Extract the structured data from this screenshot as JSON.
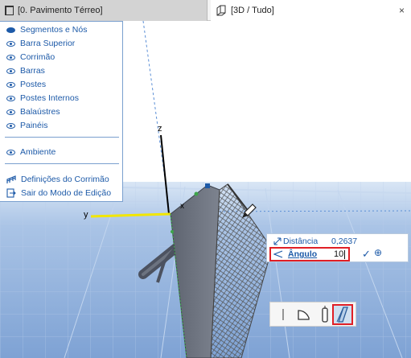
{
  "tabs": {
    "floor_plan": {
      "label": "[0. Pavimento Térreo]",
      "icon": "floor-plan-icon"
    },
    "view_3d": {
      "label": "[3D / Tudo]",
      "icon": "3d-window-icon",
      "close": "×"
    }
  },
  "palette": {
    "items": [
      {
        "label": "Segmentos e Nós",
        "icon": "eye-icon-filled"
      },
      {
        "label": "Barra Superior",
        "icon": "eye-icon"
      },
      {
        "label": "Corrimão",
        "icon": "eye-icon"
      },
      {
        "label": "Barras",
        "icon": "eye-icon"
      },
      {
        "label": "Postes",
        "icon": "eye-icon"
      },
      {
        "label": "Postes Internos",
        "icon": "eye-icon"
      },
      {
        "label": "Balaústres",
        "icon": "eye-icon"
      },
      {
        "label": "Painéis",
        "icon": "eye-icon"
      }
    ],
    "environment": {
      "label": "Ambiente",
      "icon": "eye-icon"
    },
    "settings": {
      "label": "Definições do Corrimão",
      "icon": "railing-settings-icon"
    },
    "exit": {
      "label": "Sair do Modo de Edição",
      "icon": "exit-edit-icon"
    }
  },
  "axes": {
    "x": "x",
    "y": "y",
    "z": "z"
  },
  "tracker": {
    "distance": {
      "label": "Distância",
      "value": "0,2637",
      "icon": "distance-icon"
    },
    "angle": {
      "label": "Ângulo",
      "value": "10",
      "icon": "angle-icon"
    },
    "confirm_icon": "checkmark-icon",
    "snap_icon": "crosshair-icon"
  },
  "method_toolbar": {
    "buttons": [
      {
        "icon": "straight-segment-icon",
        "selected": false
      },
      {
        "icon": "curved-segment-icon",
        "selected": false
      },
      {
        "icon": "post-icon",
        "selected": false
      },
      {
        "icon": "slanted-panel-icon",
        "selected": true
      }
    ]
  },
  "colors": {
    "accent": "#1d5aa8",
    "highlight": "#e01f26",
    "y_axis": "#f2e600",
    "sky_top": "#ffffff",
    "ground": "#9ab8df"
  }
}
